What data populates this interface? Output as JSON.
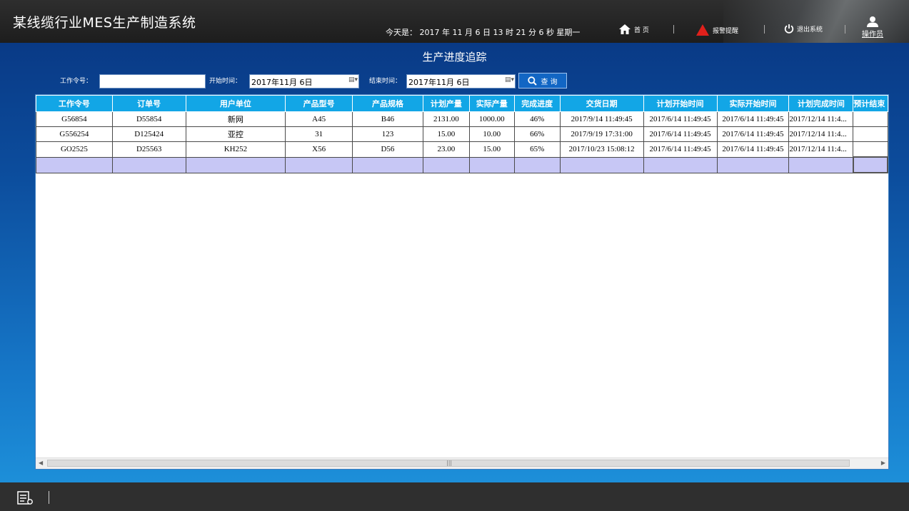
{
  "header": {
    "app_title": "某线缆行业MES生产制造系统",
    "datetime": "今天是： 2017 年 11 月 6 日 13 时 21 分 6 秒    星期一",
    "nav": {
      "home": "首 页",
      "alarm": "报警提醒",
      "exit": "退出系统",
      "user": "操作员"
    }
  },
  "page": {
    "title": "生产进度追踪"
  },
  "filters": {
    "work_order_label": "工作令号：",
    "work_order_value": "",
    "start_label": "开始时间：",
    "start_value": "2017年11月  6日",
    "end_label": "结束时间：",
    "end_value": "2017年11月  6日",
    "query_label": "查 询"
  },
  "table": {
    "columns": [
      "工作令号",
      "订单号",
      "用户单位",
      "产品型号",
      "产品规格",
      "计划产量",
      "实际产量",
      "完成进度",
      "交货日期",
      "计划开始时间",
      "实际开始时间",
      "计划完成时间",
      "预计结束"
    ],
    "rows": [
      [
        "G56854",
        "D55854",
        "新网",
        "A45",
        "B46",
        "2131.00",
        "1000.00",
        "46%",
        "2017/9/14 11:49:45",
        "2017/6/14 11:49:45",
        "2017/6/14 11:49:45",
        "2017/12/14 11:4...",
        ""
      ],
      [
        "G556254",
        "D125424",
        "亚控",
        "31",
        "123",
        "15.00",
        "10.00",
        "66%",
        "2017/9/19 17:31:00",
        "2017/6/14 11:49:45",
        "2017/6/14 11:49:45",
        "2017/12/14 11:4...",
        ""
      ],
      [
        "GO2525",
        "D25563",
        "KH252",
        "X56",
        "D56",
        "23.00",
        "15.00",
        "65%",
        "2017/10/23 15:08:12",
        "2017/6/14 11:49:45",
        "2017/6/14 11:49:45",
        "2017/12/14 11:4...",
        ""
      ]
    ]
  },
  "icons": {
    "home": "home-icon",
    "alarm": "alarm-icon",
    "exit": "power-icon",
    "user": "user-icon",
    "calendar": "calendar-dropdown-icon",
    "search": "search-icon",
    "settings": "list-settings-icon"
  },
  "colors": {
    "header_bg": "#12a6e6",
    "empty_row": "#c7c7f5",
    "alarm": "#e0201b"
  }
}
